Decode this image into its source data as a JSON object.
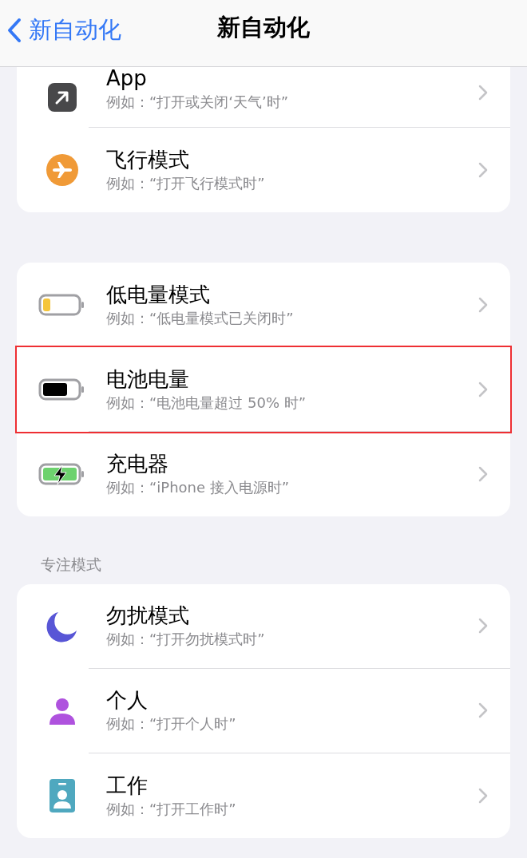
{
  "nav": {
    "back_label": "新自动化",
    "title": "新自动化"
  },
  "sections": [
    {
      "rows": [
        {
          "kind": "app",
          "title": "App",
          "subtitle": "例如：“打开或关闭‘天气’时”",
          "highlighted": false
        },
        {
          "kind": "airplane",
          "title": "飞行模式",
          "subtitle": "例如：“打开飞行模式时”",
          "highlighted": false
        }
      ]
    },
    {
      "rows": [
        {
          "kind": "low-battery",
          "title": "低电量模式",
          "subtitle": "例如：“低电量模式已关闭时”",
          "highlighted": false
        },
        {
          "kind": "battery",
          "title": "电池电量",
          "subtitle": "例如：“电池电量超过 50% 时”",
          "highlighted": true
        },
        {
          "kind": "charger",
          "title": "充电器",
          "subtitle": "例如：“iPhone 接入电源时”",
          "highlighted": false
        }
      ]
    },
    {
      "header": "专注模式",
      "rows": [
        {
          "kind": "moon",
          "title": "勿扰模式",
          "subtitle": "例如：“打开勿扰模式时”",
          "highlighted": false
        },
        {
          "kind": "person",
          "title": "个人",
          "subtitle": "例如：“打开个人时”",
          "highlighted": false
        },
        {
          "kind": "badge",
          "title": "工作",
          "subtitle": "例如：“打开工作时”",
          "highlighted": false
        }
      ]
    }
  ]
}
